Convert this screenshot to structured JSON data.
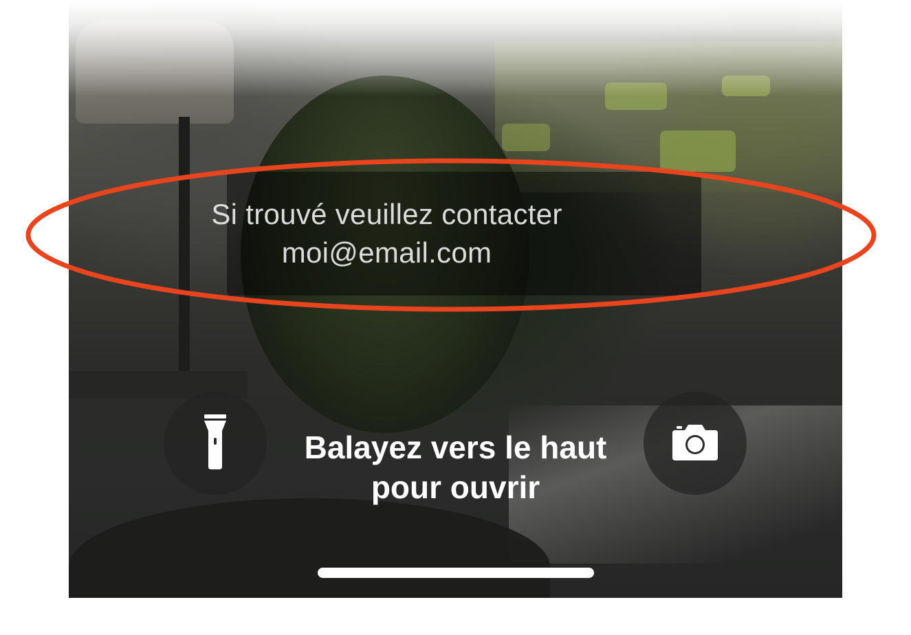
{
  "lock_screen": {
    "message_line1": "Si trouvé veuillez contacter",
    "message_line2": "moi@email.com",
    "swipe_line1": "Balayez vers le haut",
    "swipe_line2": "pour ouvrir",
    "flashlight_icon": "flashlight-icon",
    "camera_icon": "camera-icon"
  },
  "annotation": {
    "highlight_color": "#e8451e"
  }
}
